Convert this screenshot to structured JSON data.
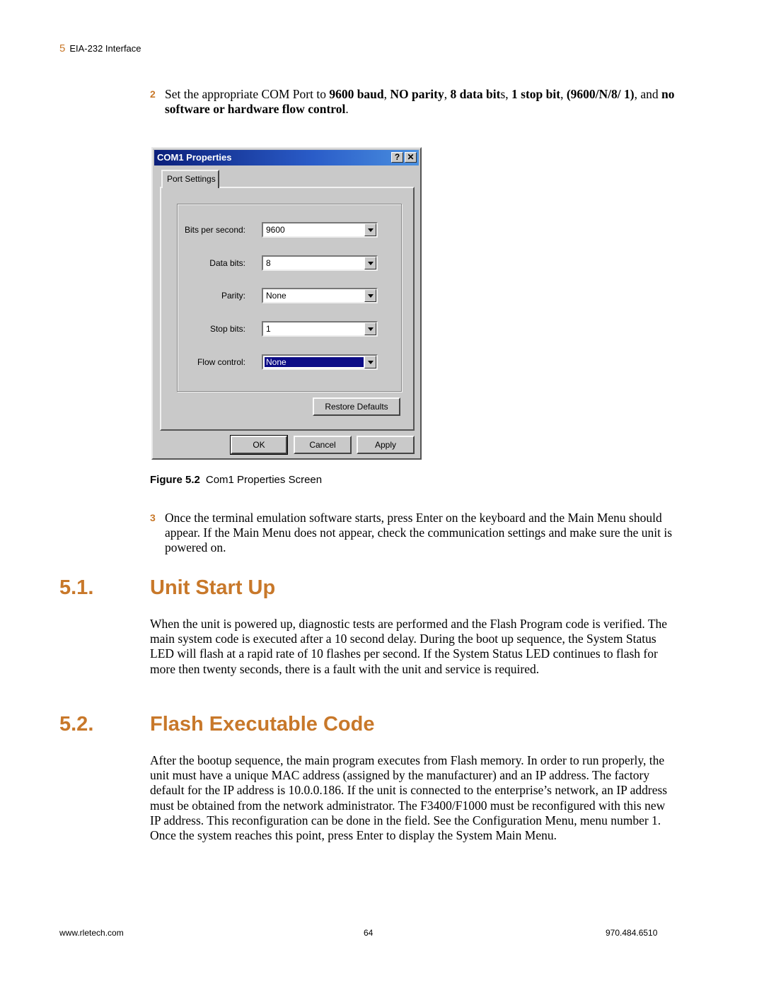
{
  "running_head": {
    "chapter": "5",
    "title": "EIA-232 Interface"
  },
  "steps": [
    {
      "number": "2",
      "parts": {
        "p1": "Set the appropriate COM Port to ",
        "b1": "9600 baud",
        "p2": ", ",
        "b2": "NO parity",
        "p3": ", ",
        "b3": "8 data bit",
        "p4": "s, ",
        "b4": "1 stop bit",
        "p5": ", ",
        "b5": "(9600/N/8/ 1)",
        "p6": ", and ",
        "b6": "no software or hardware flow control",
        "p7": "."
      }
    },
    {
      "number": "3",
      "text": "Once the terminal emulation software starts, press Enter on the keyboard and the Main Menu should appear. If the Main Menu does not appear, check the communication settings and make sure the unit is powered on."
    }
  ],
  "dialog": {
    "title": "COM1 Properties",
    "help_button": "?",
    "close_button": "✕",
    "tab_label": "Port Settings",
    "fields": [
      {
        "label": "Bits per second:",
        "value": "9600"
      },
      {
        "label": "Data bits:",
        "value": "8"
      },
      {
        "label": "Parity:",
        "value": "None"
      },
      {
        "label": "Stop bits:",
        "value": "1"
      },
      {
        "label": "Flow control:",
        "value": "None"
      }
    ],
    "restore_defaults": "Restore Defaults",
    "ok": "OK",
    "cancel": "Cancel",
    "apply": "Apply"
  },
  "figure": {
    "number": "Figure 5.2",
    "caption": "Com1 Properties Screen"
  },
  "sections": [
    {
      "number": "5.1.",
      "title": "Unit Start Up",
      "body": "When the unit is powered up, diagnostic tests are performed and the Flash Program code is verified. The main system code is executed after a 10 second delay. During the boot up sequence, the System Status LED will flash at a rapid rate of 10 flashes per second. If the System Status LED continues to flash for more then twenty seconds, there is a fault with the unit and service is required."
    },
    {
      "number": "5.2.",
      "title": "Flash Executable Code",
      "body": "After the bootup sequence, the main program executes from Flash memory. In order to run properly, the unit must have a unique MAC address (assigned by the manufacturer) and an IP address. The factory default for the IP address is 10.0.0.186. If the unit is connected to the enterprise’s network, an IP address must be obtained from the network administrator. The F3400/F1000 must be reconfigured with this new IP address. This reconfiguration can be done in the field. See the Configuration Menu, menu number 1. Once the system reaches this point, press Enter to display the System Main Menu."
    }
  ],
  "footer": {
    "website": "www.rletech.com",
    "page": "64",
    "phone": "970.484.6510"
  },
  "colors": {
    "accent": "#c8782a",
    "title_bar": "#0b1f7a",
    "selection": "#0c0c86",
    "dialog_face": "#c9c9c9"
  }
}
